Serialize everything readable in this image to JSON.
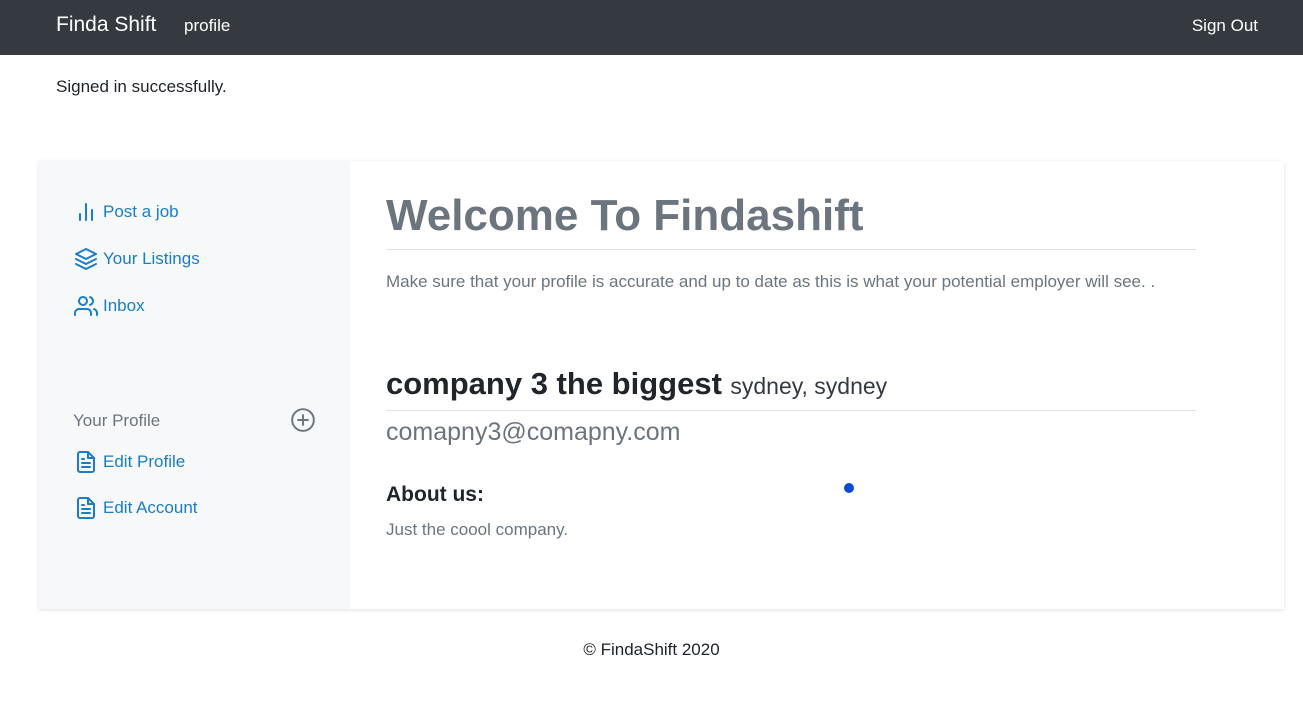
{
  "navbar": {
    "brand": "Finda Shift",
    "profile_link": "profile",
    "sign_out": "Sign Out"
  },
  "flash": "Signed in successfully.",
  "sidebar": {
    "items": [
      {
        "label": "Post a job",
        "icon": "bar-chart-icon"
      },
      {
        "label": "Your Listings",
        "icon": "layers-icon"
      },
      {
        "label": "Inbox",
        "icon": "users-icon"
      }
    ],
    "profile_heading": "Your Profile",
    "profile_items": [
      {
        "label": "Edit Profile",
        "icon": "file-text-icon"
      },
      {
        "label": "Edit Account",
        "icon": "file-text-icon"
      }
    ]
  },
  "main": {
    "welcome": "Welcome To Findashift",
    "intro": "Make sure that your profile is accurate and up to date as this is what your potential employer will see. .",
    "company_name": "company 3 the biggest",
    "company_location": "sydney, sydney",
    "email": "comapny3@comapny.com",
    "about_title": "About us:",
    "about_text": "Just the coool company."
  },
  "footer": "© FindaShift 2020",
  "colors": {
    "navbar_bg": "#343a40",
    "link": "#1a7dc9",
    "sidebar_bg": "#f7f8f9",
    "muted": "#6c757d"
  }
}
